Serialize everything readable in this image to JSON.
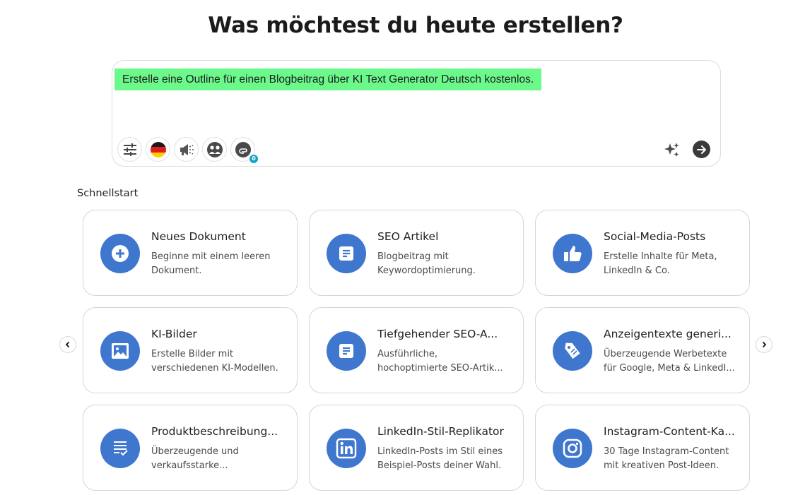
{
  "header": {
    "title": "Was möchtest du heute erstellen?"
  },
  "prompt": {
    "text": "Erstelle eine Outline für einen Blogbeitrag über KI Text Generator Deutsch kostenlos.",
    "attachment_count": "0",
    "tools": [
      "settings-sliders-icon",
      "german-flag-icon",
      "megaphone-icon",
      "persona-icon",
      "paperclip-icon"
    ]
  },
  "quickstart": {
    "label": "Schnellstart",
    "cards": [
      {
        "title": "Neues Dokument",
        "desc1": "Beginne mit einem leeren",
        "desc2": "Dokument.",
        "icon": "plus-circle-icon"
      },
      {
        "title": "SEO Artikel",
        "desc1": "Blogbeitrag mit",
        "desc2": "Keywordoptimierung.",
        "icon": "document-icon"
      },
      {
        "title": "Social-Media-Posts",
        "desc1": "Erstelle Inhalte für Meta,",
        "desc2": "LinkedIn & Co.",
        "icon": "thumbs-up-icon"
      },
      {
        "title": "KI-Bilder",
        "desc1": "Erstelle Bilder mit",
        "desc2": "verschiedenen KI-Modellen.",
        "icon": "image-icon"
      },
      {
        "title": "Tiefgehender SEO-A...",
        "desc1": "Ausführliche,",
        "desc2": "hochoptimierte SEO-Artik...",
        "icon": "document-icon"
      },
      {
        "title": "Anzeigentexte generi...",
        "desc1": "Überzeugende Werbetexte",
        "desc2": "für Google, Meta & LinkedI...",
        "icon": "price-tag-icon"
      },
      {
        "title": "Produktbeschreibung...",
        "desc1": "Überzeugende und",
        "desc2": "verkaufsstarke...",
        "icon": "checklist-icon"
      },
      {
        "title": "LinkedIn-Stil-Replikator",
        "desc1": "LinkedIn-Posts im Stil eines",
        "desc2": "Beispiel-Posts deiner Wahl.",
        "icon": "linkedin-icon"
      },
      {
        "title": "Instagram-Content-Ka...",
        "desc1": "30 Tage Instagram-Content",
        "desc2": "mit kreativen Post-Ideen.",
        "icon": "instagram-icon"
      }
    ]
  },
  "colors": {
    "accent": "#3f77cf",
    "highlight": "#6cf98c",
    "badge": "#13a4c9"
  }
}
